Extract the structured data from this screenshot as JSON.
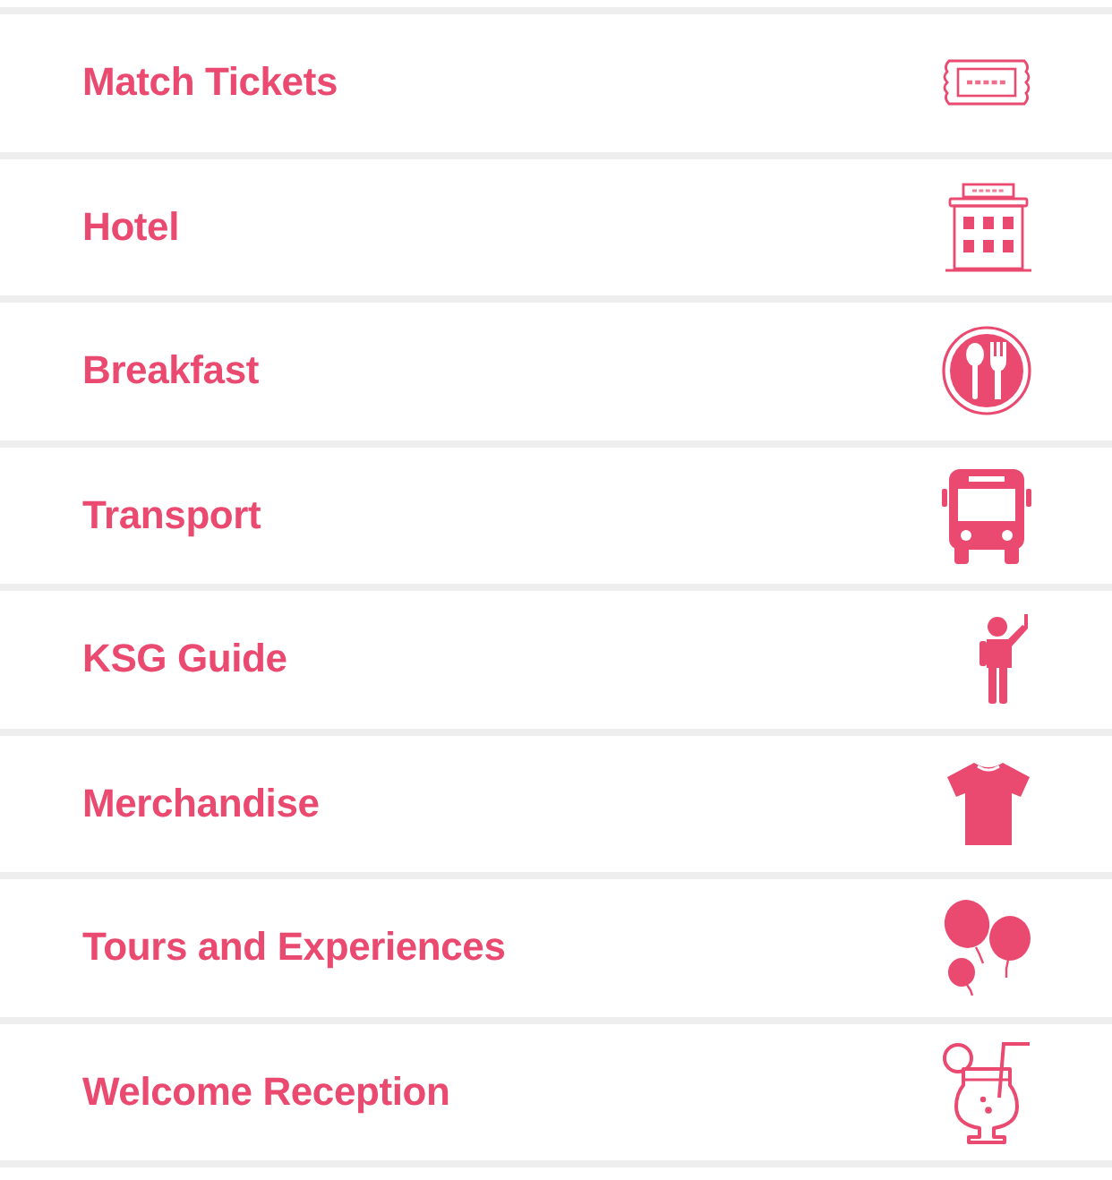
{
  "menu": {
    "items": [
      {
        "label": "Match Tickets",
        "kind": "ticket"
      },
      {
        "label": "Hotel",
        "kind": "hotel"
      },
      {
        "label": "Breakfast",
        "kind": "breakfast"
      },
      {
        "label": "Transport",
        "kind": "transport"
      },
      {
        "label": "KSG Guide",
        "kind": "guide"
      },
      {
        "label": "Merchandise",
        "kind": "merchandise"
      },
      {
        "label": "Tours and Experiences",
        "kind": "tours"
      },
      {
        "label": "Welcome Reception",
        "kind": "reception"
      }
    ]
  }
}
